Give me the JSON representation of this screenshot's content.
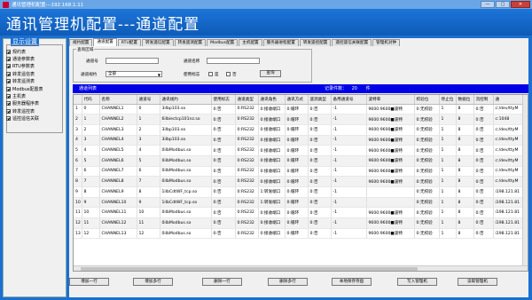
{
  "window": {
    "title": "通讯管理机配置---192.168.1.11",
    "buttons": {
      "minimize": "—",
      "maximize": "□",
      "close": "✕"
    }
  },
  "banner": {
    "heading": "通讯管理机配置---通道配置"
  },
  "sidebar": {
    "legend": "显示设置",
    "items": [
      {
        "label": "规约表",
        "checked": true
      },
      {
        "label": "通道参数表",
        "checked": true
      },
      {
        "label": "RTU参数表",
        "checked": true
      },
      {
        "label": "转发遥信表",
        "checked": true
      },
      {
        "label": "转发遥测表",
        "checked": true
      },
      {
        "label": "Modbus配置表",
        "checked": true
      },
      {
        "label": "主机表",
        "checked": true
      },
      {
        "label": "服务器程序表",
        "checked": true
      },
      {
        "label": "转发遥控表",
        "checked": true
      },
      {
        "label": "遥控遥信关联",
        "checked": true
      }
    ]
  },
  "tabs": [
    {
      "label": "规约配置",
      "active": false
    },
    {
      "label": "通道配置",
      "active": true
    },
    {
      "label": "RTU配置",
      "active": false
    },
    {
      "label": "转发遥信配置",
      "active": false
    },
    {
      "label": "转发遥测配置",
      "active": false
    },
    {
      "label": "Modbus配置",
      "active": false
    },
    {
      "label": "主机配置",
      "active": false
    },
    {
      "label": "服务器进程配置",
      "active": false
    },
    {
      "label": "转发遥控配置",
      "active": false
    },
    {
      "label": "遥控遥信关联配置",
      "active": false
    },
    {
      "label": "管理机对钟",
      "active": false
    }
  ],
  "query": {
    "legend": "查询区域",
    "channel_no_label": "通道号",
    "channel_no_value": "",
    "channel_name_label": "通道名称",
    "channel_name_value": "",
    "protocol_label": "通道规约",
    "protocol_value": "全部",
    "flag_label": "使用标志",
    "yes_label": "是",
    "no_label": "否",
    "query_button": "查询"
  },
  "list": {
    "title": "通道列表",
    "record_label": "记录件数：",
    "record_count": "20",
    "record_unit": "件"
  },
  "table": {
    "columns": [
      "",
      "代码",
      "名称",
      "通道号",
      "通讯规约",
      "使用标志",
      "通道类型",
      "通讯角色",
      "通讯方式",
      "遥测类型",
      "备用通道号",
      "波特率",
      "校验位",
      "停止位",
      "数据位",
      "流控制",
      "通"
    ],
    "rows": [
      [
        "1",
        "0",
        "CHANNEL1",
        "0",
        "3ilbp103.so",
        "0:否",
        "0:RS232",
        "0:接收端口",
        "0:循环",
        "0:否",
        "-1",
        "9600:9600■波特",
        "0:无校验",
        "1",
        "8",
        "0:否",
        "c:/dev/ttyM"
      ],
      [
        "2",
        "1",
        "CHANNEL2",
        "1",
        "6ilbiectcp101nz.so",
        "0:否",
        "0:RS232",
        "0:接收端口",
        "0:循环",
        "0:否",
        "-1",
        "9600:9600■波特",
        "0:无校验",
        "1",
        "8",
        "0:否",
        "c:1048"
      ],
      [
        "3",
        "2",
        "CHANNEL3",
        "2",
        "3ilbp103.so",
        "0:否",
        "0:RS232",
        "0:接收端口",
        "0:循环",
        "0:否",
        "-1",
        "9600:9600■波特",
        "0:无校验",
        "1",
        "8",
        "0:否",
        "c:/dev/ttyM"
      ],
      [
        "4",
        "3",
        "CHANNEL4",
        "3",
        "3ilbp103.so",
        "0:否",
        "0:RS232",
        "0:接收端口",
        "0:循环",
        "0:否",
        "-1",
        "9600:9600■波特",
        "0:无校验",
        "1",
        "8",
        "0:否",
        "c:/dev/ttyM"
      ],
      [
        "5",
        "4",
        "CHANNEL5",
        "4",
        "0ilbModbus.so",
        "0:否",
        "0:RS232",
        "0:接收端口",
        "0:循环",
        "0:否",
        "-1",
        "9600:9600■波特",
        "0:无校验",
        "1",
        "8",
        "0:否",
        "c:/dev/ttyM"
      ],
      [
        "6",
        "5",
        "CHANNEL6",
        "5",
        "0ilbModbus.so",
        "0:否",
        "0:RS232",
        "0:接收端口",
        "0:循环",
        "0:否",
        "-1",
        "9600:9600■波特",
        "0:无校验",
        "1",
        "8",
        "0:否",
        "c:/dev/ttyM"
      ],
      [
        "7",
        "6",
        "CHANNEL7",
        "6",
        "0ilbModbus.so",
        "0:否",
        "0:RS232",
        "0:接收端口",
        "0:循环",
        "0:否",
        "-1",
        "9600:9600■波特",
        "0:无校验",
        "1",
        "8",
        "0:否",
        "c:/dev/ttyM"
      ],
      [
        "8",
        "7",
        "CHANNEL8",
        "7",
        "0ilbModbus.so",
        "0:否",
        "0:RS232",
        "0:接收端口",
        "0:循环",
        "0:否",
        "-1",
        "9600:9600■波特",
        "0:无校验",
        "1",
        "8",
        "0:否",
        "c:/dev/ttyM"
      ],
      [
        "9",
        "8",
        "CHANNEL9",
        "8",
        "1ilbCdtWF_tcp.so",
        "0:否",
        "0:RS232",
        "1:转发端口",
        "0:循环",
        "0:否",
        "-1",
        "",
        "0:无校验",
        "1",
        "8",
        "0:否",
        "i198.121.81"
      ],
      [
        "10",
        "9",
        "CHANNEL10",
        "9",
        "1ilbCdtWF_tcp.so",
        "0:否",
        "0:RS232",
        "1:转发端口",
        "0:循环",
        "0:否",
        "-1",
        "",
        "0:无校验",
        "1",
        "8",
        "0:否",
        "i198.121.81"
      ],
      [
        "11",
        "10",
        "CHANNEL11",
        "10",
        "0ilbModbus.so",
        "0:否",
        "0:RS232",
        "0:接收端口",
        "0:循环",
        "0:否",
        "-1",
        "9600:9600■波特",
        "0:无校验",
        "1",
        "8",
        "0:否",
        "i198.121.81"
      ],
      [
        "12",
        "11",
        "CHANNEL12",
        "11",
        "0ilbModbus.so",
        "0:否",
        "0:RS232",
        "0:接收端口",
        "0:循环",
        "0:否",
        "-1",
        "9600:9600■波特",
        "0:无校验",
        "1",
        "8",
        "0:否",
        "i198.121.81"
      ],
      [
        "13",
        "12",
        "CHANNEL13",
        "12",
        "0ilbModbus.so",
        "0:否",
        "0:RS232",
        "0:接收端口",
        "0:循环",
        "0:否",
        "-1",
        "9600:9600■波特",
        "0:无校验",
        "1",
        "8",
        "0:否",
        "i198.121.81"
      ]
    ]
  },
  "actions": [
    "增加一行",
    "增加多行",
    "删除一行",
    "删除多行",
    "本地保存存盘",
    "写入管理机",
    "读取管理机"
  ]
}
